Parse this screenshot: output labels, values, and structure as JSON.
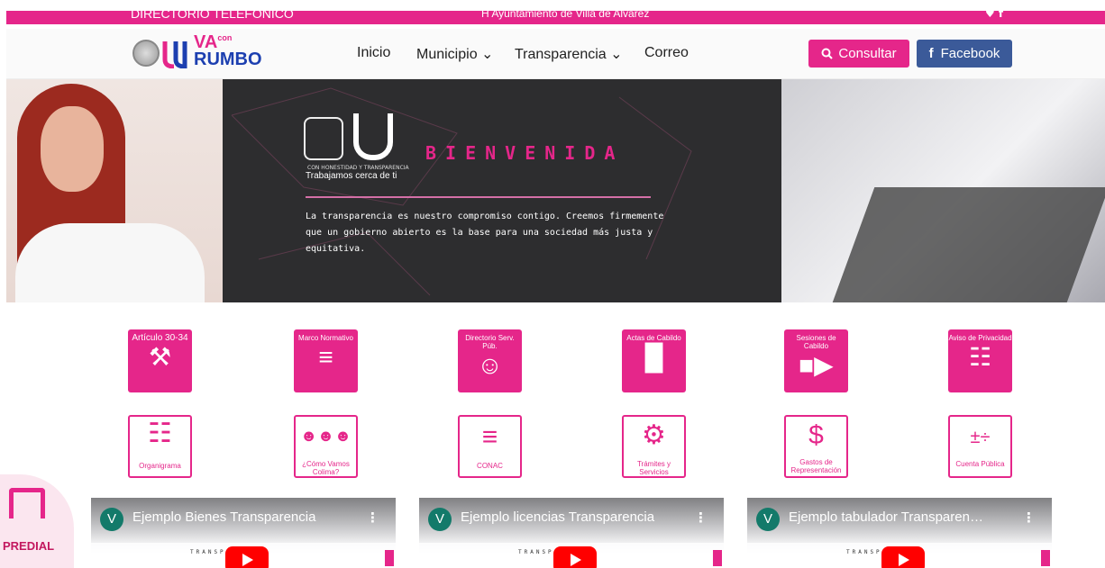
{
  "topbar": {
    "directory_link": "DIRECTORIO TELEFONICO",
    "city_hall": "H Ayuntamiento de Villa de Alvarez",
    "social_icons": "♥ f"
  },
  "header": {
    "logo": {
      "va": "VA",
      "con": "con",
      "rumbo": "RUMBO"
    },
    "nav": [
      {
        "label": "Inicio"
      },
      {
        "label": "Municipio ⌄"
      },
      {
        "label": "Transparencia ⌄"
      },
      {
        "label": "Correo"
      }
    ],
    "consultar_label": "Consultar",
    "facebook_label": "Facebook",
    "colors": {
      "accent": "#e5268a",
      "facebook": "#3b5a99"
    }
  },
  "banner": {
    "motto_small": "CON HONESTIDAD Y TRANSPARENCIA",
    "motto": "Trabajamos cerca de ti",
    "title": "BIENVENIDA",
    "text": "La transparencia es nuestro compromiso contigo. Creemos firmemente que un gobierno abierto es la base para una sociedad más justa y equitativa."
  },
  "tiles_filled": [
    {
      "label": "Artículo 30-34",
      "icon": "gavel-icon",
      "glyph": "⚒"
    },
    {
      "label": "Marco Normativo",
      "icon": "layers-icon",
      "glyph": "≡"
    },
    {
      "label": "Directorio Serv. Púb.",
      "icon": "users-icon",
      "glyph": "☺"
    },
    {
      "label": "Actas de Cabildo",
      "icon": "binders-icon",
      "glyph": "▐▌"
    },
    {
      "label": "Sesiones de Cabildo",
      "icon": "video-camera-icon",
      "glyph": "■▶"
    },
    {
      "label": "Aviso de Privacidad",
      "icon": "document-icon",
      "glyph": "☷"
    }
  ],
  "tiles_outline": [
    {
      "label": "Organigrama",
      "icon": "org-chart-icon",
      "glyph": "☷"
    },
    {
      "label": "¿Cómo Vamos Colima?",
      "icon": "people-group-icon",
      "glyph": "☻☻☻"
    },
    {
      "label": "CONAC",
      "icon": "coins-chart-icon",
      "glyph": "≡"
    },
    {
      "label": "Trámites y Servicios",
      "icon": "gears-icon",
      "glyph": "⚙"
    },
    {
      "label": "Gastos de Representación",
      "icon": "invoice-icon",
      "glyph": "$"
    },
    {
      "label": "Cuenta Pública",
      "icon": "calculator-icon",
      "glyph": "±÷"
    }
  ],
  "predial_label": "PREDIAL",
  "videos": [
    {
      "avatar": "V",
      "title": "Ejemplo Bienes Transparencia",
      "platform": "TRANSPARENCIA"
    },
    {
      "avatar": "V",
      "title": "Ejemplo licencias Transparencia",
      "platform": "TRANSPARENCIA"
    },
    {
      "avatar": "V",
      "title": "Ejemplo tabulador Transparen…",
      "platform": "TRANSPARENCIA"
    }
  ]
}
